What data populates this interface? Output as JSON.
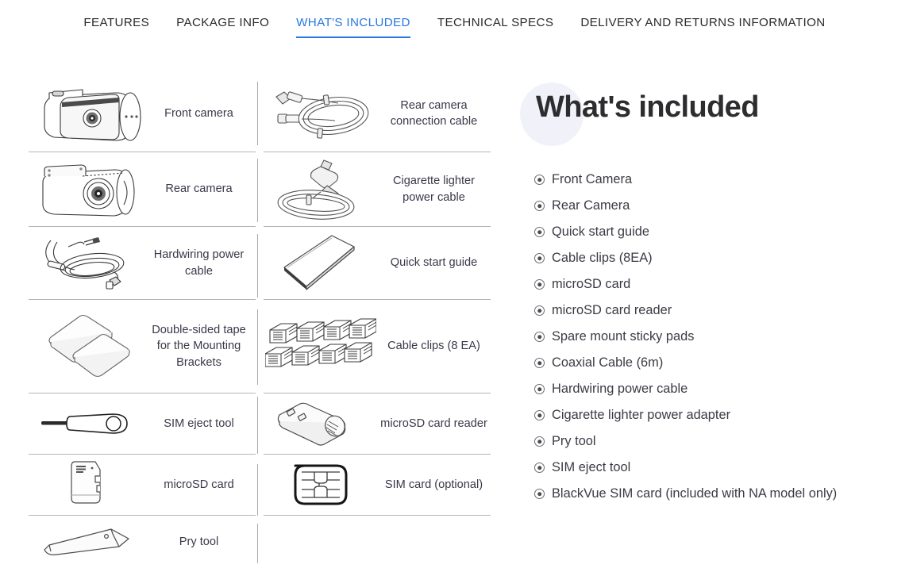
{
  "nav": {
    "tabs": [
      {
        "label": "FEATURES",
        "active": false
      },
      {
        "label": "PACKAGE INFO",
        "active": false
      },
      {
        "label": "WHAT'S INCLUDED",
        "active": true
      },
      {
        "label": "TECHNICAL SPECS",
        "active": false
      },
      {
        "label": "DELIVERY AND RETURNS INFORMATION",
        "active": false
      }
    ],
    "active_color": "#2878e0",
    "inactive_color": "#2b2b2b"
  },
  "grid": {
    "left_column": [
      {
        "label": "Front camera",
        "icon": "front-camera-illustration"
      },
      {
        "label": "Rear camera",
        "icon": "rear-camera-illustration"
      },
      {
        "label": "Hardwiring power cable",
        "icon": "hardwiring-power-cable-illustration"
      },
      {
        "label": "Double-sided tape for the Mounting Brackets",
        "icon": "double-sided-tape-illustration"
      },
      {
        "label": "SIM eject tool",
        "icon": "sim-eject-tool-illustration"
      },
      {
        "label": "microSD card",
        "icon": "microsd-card-illustration"
      },
      {
        "label": "Pry tool",
        "icon": "pry-tool-illustration"
      }
    ],
    "right_column": [
      {
        "label": "Rear camera connection cable",
        "icon": "rear-camera-cable-illustration"
      },
      {
        "label": "Cigarette lighter power cable",
        "icon": "cigarette-lighter-cable-illustration"
      },
      {
        "label": "Quick start guide",
        "icon": "quick-start-guide-illustration"
      },
      {
        "label": "Cable clips (8 EA)",
        "icon": "cable-clips-illustration"
      },
      {
        "label": "microSD card reader",
        "icon": "microsd-card-reader-illustration"
      },
      {
        "label": "SIM card (optional)",
        "icon": "sim-card-illustration"
      }
    ]
  },
  "panel": {
    "heading": "What's included",
    "blob_color": "#f1f1fa",
    "items": [
      "Front Camera",
      "Rear Camera",
      "Quick start guide",
      "Cable clips (8EA)",
      "microSD card",
      "microSD card reader",
      "Spare mount sticky pads",
      "Coaxial Cable (6m)",
      "Hardwiring power cable",
      "Cigarette lighter power adapter",
      "Pry tool",
      "SIM eject tool",
      "BlackVue SIM card (included with NA model only)"
    ]
  }
}
